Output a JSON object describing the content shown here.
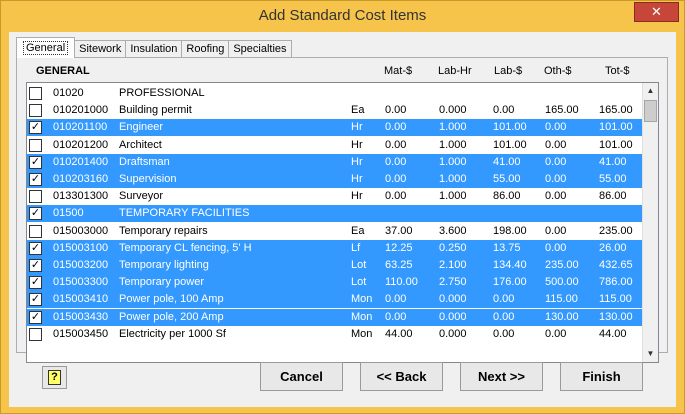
{
  "window": {
    "title": "Add Standard Cost Items",
    "close_label": "✕"
  },
  "tabs": [
    {
      "label": "General",
      "active": true
    },
    {
      "label": "Sitework",
      "active": false
    },
    {
      "label": "Insulation",
      "active": false
    },
    {
      "label": "Roofing",
      "active": false
    },
    {
      "label": "Specialties",
      "active": false
    }
  ],
  "columns": {
    "section": "GENERAL",
    "mat": "Mat-$",
    "lab_hr": "Lab-Hr",
    "lab_d": "Lab-$",
    "oth": "Oth-$",
    "tot": "Tot-$"
  },
  "rows": [
    {
      "checked": false,
      "selected": false,
      "code": "01020",
      "desc": "PROFESSIONAL",
      "unit": "",
      "mat": "",
      "lab_hr": "",
      "lab_d": "",
      "oth": "",
      "tot": ""
    },
    {
      "checked": false,
      "selected": false,
      "code": "010201000",
      "desc": "Building permit",
      "unit": "Ea",
      "mat": "0.00",
      "lab_hr": "0.000",
      "lab_d": "0.00",
      "oth": "165.00",
      "tot": "165.00"
    },
    {
      "checked": true,
      "selected": true,
      "code": "010201100",
      "desc": "Engineer",
      "unit": "Hr",
      "mat": "0.00",
      "lab_hr": "1.000",
      "lab_d": "101.00",
      "oth": "0.00",
      "tot": "101.00"
    },
    {
      "checked": false,
      "selected": false,
      "code": "010201200",
      "desc": "Architect",
      "unit": "Hr",
      "mat": "0.00",
      "lab_hr": "1.000",
      "lab_d": "101.00",
      "oth": "0.00",
      "tot": "101.00"
    },
    {
      "checked": true,
      "selected": true,
      "code": "010201400",
      "desc": "Draftsman",
      "unit": "Hr",
      "mat": "0.00",
      "lab_hr": "1.000",
      "lab_d": "41.00",
      "oth": "0.00",
      "tot": "41.00"
    },
    {
      "checked": true,
      "selected": true,
      "code": "010203160",
      "desc": "Supervision",
      "unit": "Hr",
      "mat": "0.00",
      "lab_hr": "1.000",
      "lab_d": "55.00",
      "oth": "0.00",
      "tot": "55.00"
    },
    {
      "checked": false,
      "selected": false,
      "code": "013301300",
      "desc": "Surveyor",
      "unit": "Hr",
      "mat": "0.00",
      "lab_hr": "1.000",
      "lab_d": "86.00",
      "oth": "0.00",
      "tot": "86.00"
    },
    {
      "checked": true,
      "selected": true,
      "code": "01500",
      "desc": "TEMPORARY FACILITIES",
      "unit": "",
      "mat": "",
      "lab_hr": "",
      "lab_d": "",
      "oth": "",
      "tot": ""
    },
    {
      "checked": false,
      "selected": false,
      "code": "015003000",
      "desc": "Temporary repairs",
      "unit": "Ea",
      "mat": "37.00",
      "lab_hr": "3.600",
      "lab_d": "198.00",
      "oth": "0.00",
      "tot": "235.00"
    },
    {
      "checked": true,
      "selected": true,
      "code": "015003100",
      "desc": "Temporary CL fencing, 5' H",
      "unit": "Lf",
      "mat": "12.25",
      "lab_hr": "0.250",
      "lab_d": "13.75",
      "oth": "0.00",
      "tot": "26.00"
    },
    {
      "checked": true,
      "selected": true,
      "code": "015003200",
      "desc": "Temporary lighting",
      "unit": "Lot",
      "mat": "63.25",
      "lab_hr": "2.100",
      "lab_d": "134.40",
      "oth": "235.00",
      "tot": "432.65"
    },
    {
      "checked": true,
      "selected": true,
      "code": "015003300",
      "desc": "Temporary power",
      "unit": "Lot",
      "mat": "110.00",
      "lab_hr": "2.750",
      "lab_d": "176.00",
      "oth": "500.00",
      "tot": "786.00"
    },
    {
      "checked": true,
      "selected": true,
      "code": "015003410",
      "desc": "Power pole, 100 Amp",
      "unit": "Mon",
      "mat": "0.00",
      "lab_hr": "0.000",
      "lab_d": "0.00",
      "oth": "115.00",
      "tot": "115.00"
    },
    {
      "checked": true,
      "selected": true,
      "code": "015003430",
      "desc": "Power pole, 200 Amp",
      "unit": "Mon",
      "mat": "0.00",
      "lab_hr": "0.000",
      "lab_d": "0.00",
      "oth": "130.00",
      "tot": "130.00"
    },
    {
      "checked": false,
      "selected": false,
      "code": "015003450",
      "desc": "Electricity per 1000 Sf",
      "unit": "Mon",
      "mat": "44.00",
      "lab_hr": "0.000",
      "lab_d": "0.00",
      "oth": "0.00",
      "tot": "44.00"
    }
  ],
  "buttons": {
    "help": "?",
    "cancel": "Cancel",
    "back": "<< Back",
    "next": "Next >>",
    "finish": "Finish"
  },
  "icons": {
    "help": "help-question-icon",
    "close": "close-icon"
  },
  "colors": {
    "selection": "#3399ff",
    "titlebar": "#f6c44a",
    "close": "#c7463a"
  }
}
